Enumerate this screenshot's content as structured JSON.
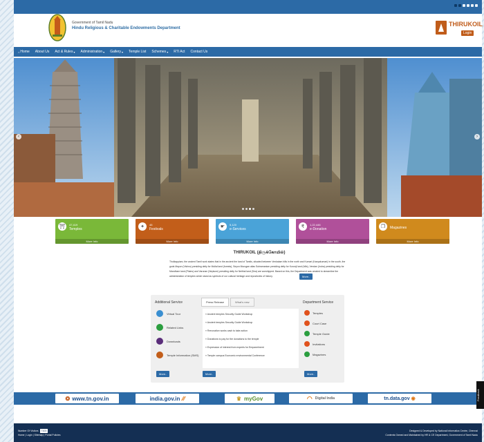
{
  "header": {
    "govt_label": "Government of Tamil Nadu",
    "dept_title": "Hindu Religious & Charitable Endowments Department",
    "brand": "THIRUKOIL",
    "login": "Login"
  },
  "nav": [
    {
      "label": "Home",
      "icon": "home-icon"
    },
    {
      "label": "About Us",
      "caret": ""
    },
    {
      "label": "Act & Rules",
      "caret": "▾"
    },
    {
      "label": "Administration",
      "caret": "▾"
    },
    {
      "label": "Gallery",
      "caret": "▾"
    },
    {
      "label": "Temple List",
      "caret": ""
    },
    {
      "label": "Schemes",
      "caret": "▾"
    },
    {
      "label": "RTI Act",
      "caret": ""
    },
    {
      "label": "Contact Us",
      "caret": ""
    }
  ],
  "cards": [
    {
      "num": "47,419",
      "label": "Temples",
      "more": "More Info",
      "color": "#7ab839"
    },
    {
      "num": "45",
      "label": "Festivals",
      "more": "More Info",
      "color": "#c25e1a"
    },
    {
      "num": "5,120",
      "label": "e-Services",
      "more": "More Info",
      "color": "#4aa3d8"
    },
    {
      "num": "1,22,446",
      "label": "e-Donation",
      "more": "More Info",
      "color": "#b0509a"
    },
    {
      "num": "",
      "label": "Magazines",
      "more": "More Info",
      "color": "#d08a1d"
    }
  ],
  "about": {
    "title": "THIRUKOIL (திருக்கோயில்)",
    "text": "Tholkappiam, the ancient Tamil work states that in the ancient the land of Tamils, situated between Venkatam hills in the north and Kumari (Kanyakumari) in the south, the gods Mayon (Vishnu) presiding deity for Mullai land (forests), Seyon Murugan alias Subramanian presiding deity for Kurunji land (hills), Vendan (Indra) presiding deity for Marutham land (Plains) and Varunan (Neptune) presiding deity for Neithal land (Sea) are worshipped. Based on this, the Department was created to streamline the administration of temples which stand as symbols of our cultural heritage and repositories of history.",
    "more": "More.."
  },
  "additional": {
    "title": "Additional Service",
    "items": [
      {
        "label": "Virtual Tour",
        "color": "#3a8fd1"
      },
      {
        "label": "Related Links",
        "color": "#2b9e3f"
      },
      {
        "label": "Downloads",
        "color": "#5a2d7a"
      },
      {
        "label": "Temple Information (SMS)",
        "color": "#c25e1a"
      }
    ],
    "more": "More.."
  },
  "press": {
    "tabs": [
      "Press Release",
      "What's new"
    ],
    "items": [
      "Ancient temples Security Guide Workshop",
      "Ancient temples Security Guide Workshop",
      "Renovation works cash to take action",
      "Donations to pay for the donations to the temple",
      "Expression of interest from experts for Empanelment",
      "Temple campus Economic environmental Conference"
    ],
    "more": "More.."
  },
  "department": {
    "title": "Department Service",
    "items": [
      {
        "label": "Temples",
        "color": "#e0521d"
      },
      {
        "label": "Court Case",
        "color": "#e0521d"
      },
      {
        "label": "Temple Guide",
        "color": "#2b9e3f"
      },
      {
        "label": "Invitations",
        "color": "#e0521d"
      },
      {
        "label": "Magazines",
        "color": "#2b9e3f"
      }
    ],
    "more": "More.."
  },
  "portals": [
    {
      "label": "www.tn.gov.in",
      "sub": "Tamil Nadu Government Portal",
      "color": "#1a4d8c"
    },
    {
      "label": "india.gov.in",
      "sub": "The National Portal of India",
      "color": "#1a4d8c"
    },
    {
      "label": "myGov",
      "sub": "",
      "color": "#5a8f2e"
    },
    {
      "label": "Digital India",
      "sub": "Power To Empower",
      "color": "#666666"
    },
    {
      "label": "tn.data.gov",
      "sub": "",
      "color": "#1a4d8c"
    }
  ],
  "footer": {
    "visitors_label": "Number Of Visitors",
    "visitors_value": "7103",
    "links": "Home | Login | Sitemap | Portal Policies",
    "credit1": "Designed & Developed by National Informatics Centre, Chennai",
    "credit2": "Contents Owned and Maintained by HR & CE Department, Government of Tamil Nadu"
  },
  "feedback": "Feedback"
}
